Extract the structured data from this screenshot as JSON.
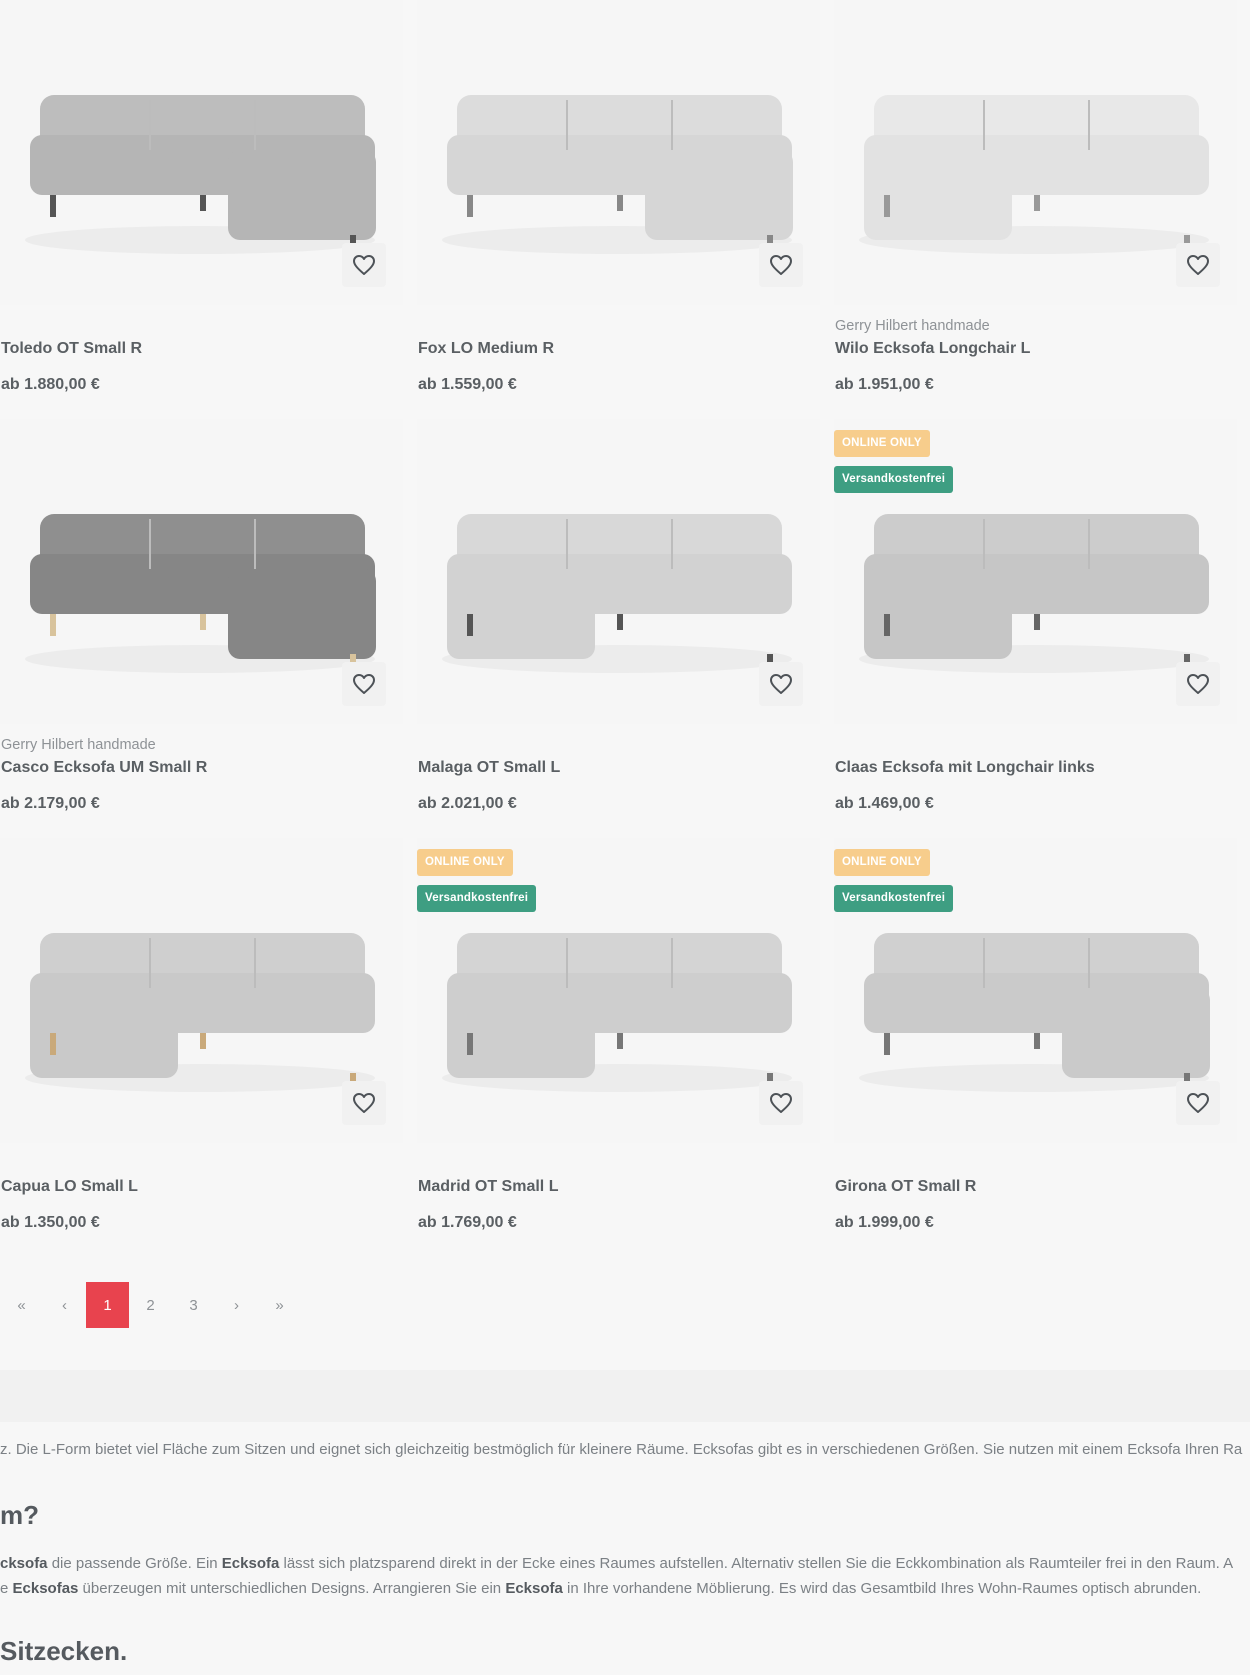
{
  "products": [
    {
      "brand": "",
      "name": "Toledo OT Small R",
      "price": "ab 1.880,00 €",
      "badges": [],
      "image": "sofa-corner-right-grey"
    },
    {
      "brand": "",
      "name": "Fox LO Medium R",
      "price": "ab 1.559,00 €",
      "badges": [],
      "image": "sofa-corner-right-light"
    },
    {
      "brand": "Gerry Hilbert handmade",
      "name": "Wilo Ecksofa Longchair L",
      "price": "ab 1.951,00 €",
      "badges": [],
      "image": "sofa-corner-left-white"
    },
    {
      "brand": "Gerry Hilbert handmade",
      "name": "Casco Ecksofa UM Small R",
      "price": "ab 2.179,00 €",
      "badges": [],
      "image": "sofa-corner-right-dark"
    },
    {
      "brand": "",
      "name": "Malaga OT Small L",
      "price": "ab 2.021,00 €",
      "badges": [],
      "image": "sofa-corner-left-light"
    },
    {
      "brand": "",
      "name": "Claas Ecksofa mit Longchair links",
      "price": "ab 1.469,00 €",
      "badges": [
        "ONLINE ONLY",
        "Versandkostenfrei"
      ],
      "image": "sofa-corner-left-grey"
    },
    {
      "brand": "",
      "name": "Capua LO Small L",
      "price": "ab 1.350,00 €",
      "badges": [],
      "image": "sofa-corner-left-wood"
    },
    {
      "brand": "",
      "name": "Madrid OT Small L",
      "price": "ab 1.769,00 €",
      "badges": [
        "ONLINE ONLY",
        "Versandkostenfrei"
      ],
      "image": "sofa-corner-left-cushions"
    },
    {
      "brand": "",
      "name": "Girona OT Small R",
      "price": "ab 1.999,00 €",
      "badges": [
        "ONLINE ONLY",
        "Versandkostenfrei"
      ],
      "image": "sofa-corner-right-tufted"
    }
  ],
  "favorite_icon": "heart-icon",
  "pagination": {
    "first": "«",
    "prev": "‹",
    "pages": [
      "1",
      "2",
      "3"
    ],
    "current": "1",
    "next": "›",
    "last": "»"
  },
  "seo": {
    "p1": "z. Die L-Form bietet viel Fläche zum Sitzen und eignet sich gleichzeitig bestmöglich für kleinere Räume. Ecksofas gibt es in verschiedenen Größen. Sie nutzen mit einem Ecksofa Ihren Ra",
    "h2": "m?",
    "p2_parts": [
      "cksofa",
      " die passende Größe. Ein ",
      "Ecksofa",
      " lässt sich platzsparend direkt in der Ecke eines Raumes aufstellen. Alternativ stellen Sie die Eckkombination als Raumteiler frei in den Raum. A"
    ],
    "p3_parts": [
      "e ",
      "Ecksofas",
      " überzeugen mit unterschiedlichen Designs. Arrangieren Sie ein ",
      "Ecksofa",
      " in Ihre vorhandene Möblierung. Es wird das Gesamtbild Ihres Wohn-Raumes optisch abrunden."
    ],
    "h3": "Sitzecken."
  },
  "colors": {
    "badge_online": "#f7cd8c",
    "badge_shipping": "#3e9e82",
    "pagination_active": "#e8434e"
  }
}
